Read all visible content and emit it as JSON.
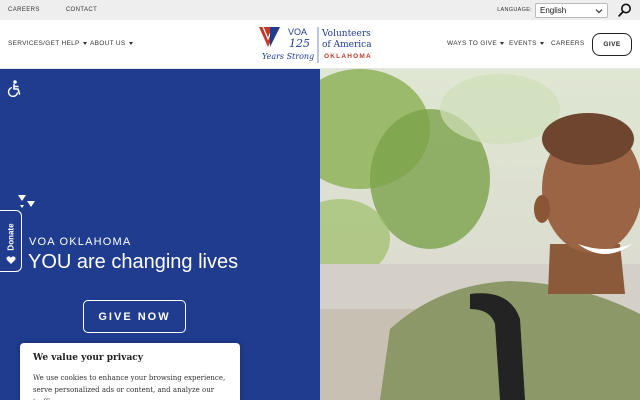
{
  "topbar": {
    "links": [
      "CAREERS",
      "CONTACT"
    ],
    "language_label": "LANGUAGE:",
    "language_value": "English"
  },
  "nav": {
    "left": [
      {
        "label": "SERVICES/GET HELP"
      },
      {
        "label": "ABOUT US"
      }
    ],
    "right": [
      {
        "label": "WAYS TO GIVE"
      },
      {
        "label": "EVENTS"
      },
      {
        "label": "CAREERS"
      }
    ],
    "give_label": "GIVE"
  },
  "logo": {
    "voa": "VOA",
    "anniversary": "125",
    "years_strong": "Years Strong",
    "org_line1": "Volunteers",
    "org_line2": "of America",
    "region": "OKLAHOMA"
  },
  "hero": {
    "eyebrow": "VOA OKLAHOMA",
    "headline": "YOU are changing lives",
    "cta": "GIVE NOW"
  },
  "donate_tab": {
    "label": "Donate"
  },
  "cookie": {
    "title": "We value your privacy",
    "body_line1": "We use cookies to enhance your browsing experience,",
    "body_line2": "serve personalized ads or content, and analyze our traffic."
  },
  "colors": {
    "hero_blue": "#1f3c8f",
    "brand_red": "#c0392b",
    "brand_navy": "#1f3c8f"
  }
}
